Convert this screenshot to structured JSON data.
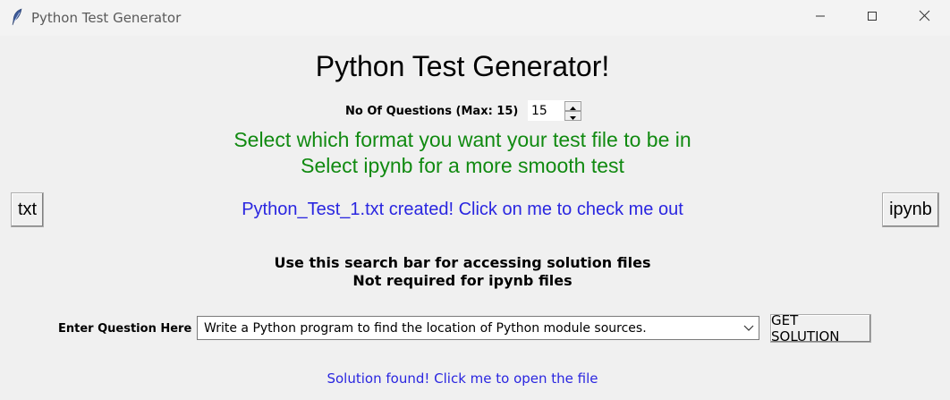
{
  "window": {
    "title": "Python Test Generator",
    "minimize_icon": "minimize-icon",
    "maximize_icon": "maximize-icon",
    "close_icon": "close-icon",
    "app_icon": "feather-icon"
  },
  "main": {
    "heading": "Python Test Generator!",
    "questions_label": "No Of Questions (Max: 15)",
    "questions_value": "15",
    "format_prompt_1": "Select which format you want your test file to be in",
    "format_prompt_2": "Select ipynb for a more smooth test",
    "txt_button": "txt",
    "ipynb_button": "ipynb",
    "created_message": "Python_Test_1.txt created! Click on me to check me out",
    "search_info_1": "Use this search bar for accessing solution files",
    "search_info_2": "Not required for ipynb files",
    "question_label": "Enter Question Here",
    "question_value": "Write a Python program to find the location of Python module sources.",
    "get_solution_button": "GET SOLUTION",
    "solution_message": "Solution found! Click me to open the file"
  },
  "colors": {
    "green_text": "#118a11",
    "link_blue": "#2a26e0"
  }
}
